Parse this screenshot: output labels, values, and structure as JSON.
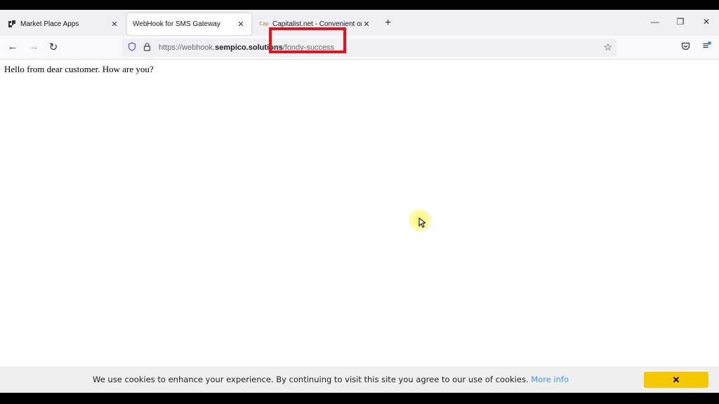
{
  "browser": {
    "tabs": [
      {
        "label": "Market Place Apps",
        "favicon": "marketplace-icon",
        "active": false
      },
      {
        "label": "WebHook for SMS Gateway",
        "favicon": "",
        "active": true
      },
      {
        "label": "Capitalist.net - Convenient onli",
        "favicon": "Cap",
        "active": false
      }
    ],
    "new_tab": "+",
    "window_controls": {
      "minimize": "—",
      "restore": "❐",
      "close": "✕"
    },
    "nav": {
      "back": "←",
      "forward": "→",
      "reload": "↻"
    },
    "url": {
      "prefix": "https://webhook.",
      "domain": "sempico.solutions",
      "path": "/fondy-success"
    },
    "bookmark_icon": "☆",
    "pocket_icon": "◡",
    "menu_icon": "≡"
  },
  "page": {
    "body_text": "Hello from dear customer. How are you?"
  },
  "cookie_banner": {
    "text": "We use cookies to enhance your experience. By continuing to visit this site you agree to our use of cookies.",
    "link": "More info",
    "close": "✕"
  }
}
